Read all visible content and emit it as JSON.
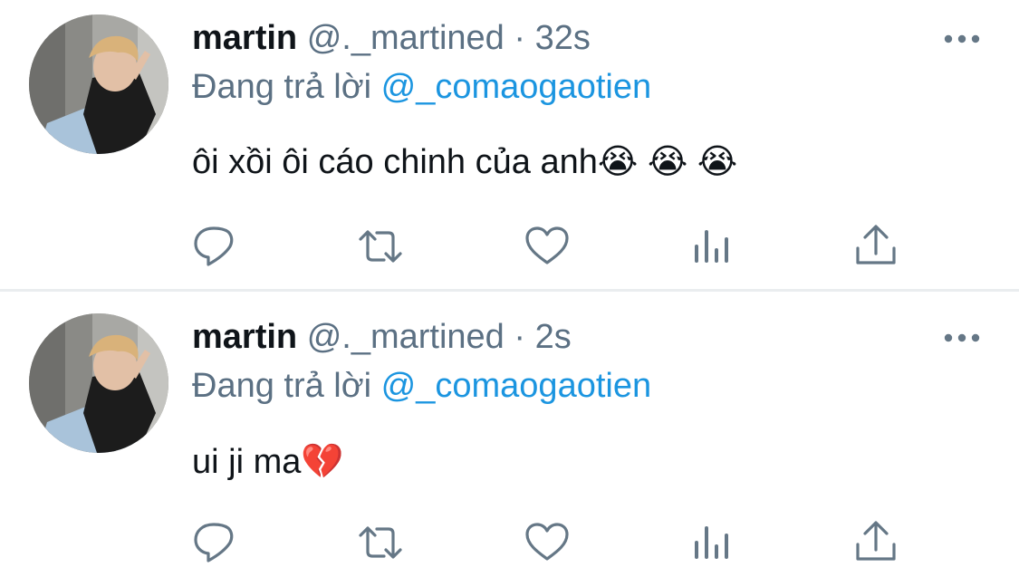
{
  "tweets": [
    {
      "display_name": "martin",
      "handle": "@._martined",
      "separator": "·",
      "timestamp": "32s",
      "reply_prefix": "Đang trả lời",
      "reply_to": "@_comaogaotien",
      "text": "ôi xồi ôi cáo chinh của anh😭 😭 😭",
      "more_icon": "more-horizontal-icon",
      "actions": [
        "reply-icon",
        "retweet-icon",
        "like-icon",
        "analytics-icon",
        "share-icon"
      ]
    },
    {
      "display_name": "martin",
      "handle": "@._martined",
      "separator": "·",
      "timestamp": "2s",
      "reply_prefix": "Đang trả lời",
      "reply_to": "@_comaogaotien",
      "text": "ui ji ma💔",
      "more_icon": "more-horizontal-icon",
      "actions": [
        "reply-icon",
        "retweet-icon",
        "like-icon",
        "analytics-icon",
        "share-icon"
      ]
    }
  ],
  "colors": {
    "primary_text": "#0f1419",
    "secondary_text": "#5b7083",
    "link": "#1b95e0",
    "icon": "#657786",
    "divider": "#eaedef"
  }
}
